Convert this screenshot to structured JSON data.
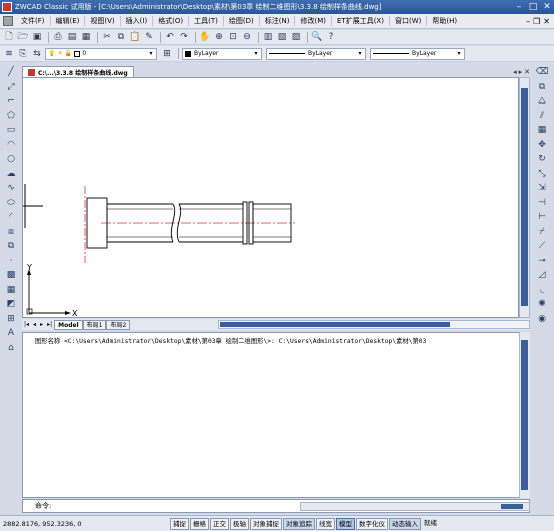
{
  "window": {
    "title": "ZWCAD Classic 试用版 - [C:\\Users\\Administrator\\Desktop\\素材\\第03章 绘制二维图形\\3.3.8 绘制样条曲线.dwg]"
  },
  "menu": {
    "items": [
      "文件(F)",
      "编辑(E)",
      "视图(V)",
      "插入(I)",
      "格式(O)",
      "工具(T)",
      "绘图(D)",
      "标注(N)",
      "修改(M)",
      "ET扩展工具(X)",
      "窗口(W)",
      "帮助(H)"
    ]
  },
  "properties": {
    "layer_value": "0",
    "color_value": "ByLayer",
    "linetype_value": "ByLayer",
    "lineweight_value": "ByLayer"
  },
  "document": {
    "tab_label": "C:\\...\\3.3.8 绘制样条曲线.dwg"
  },
  "layout_tabs": [
    "Model",
    "布局1",
    "布局2"
  ],
  "ucs": {
    "x_label": "X",
    "y_label": "Y"
  },
  "command": {
    "history": "图形名称 <C:\\Users\\Administrator\\Desktop\\素材\\第03章 绘制二维图形\\>: C:\\Users\\Administrator\\Desktop\\素材\\第03",
    "prompt": "命令:"
  },
  "status": {
    "coordinates": "2882.8176, 952.3236, 0",
    "buttons": [
      "捕捉",
      "栅格",
      "正交",
      "极轴",
      "对象捕捉",
      "对象追踪",
      "线宽",
      "模型",
      "数字化仪",
      "动态输入",
      "就绪"
    ]
  },
  "colors": {
    "titlebar": "#2f5c9e",
    "scroll_thumb": "#3b5f96",
    "centerline": "#e03030"
  }
}
